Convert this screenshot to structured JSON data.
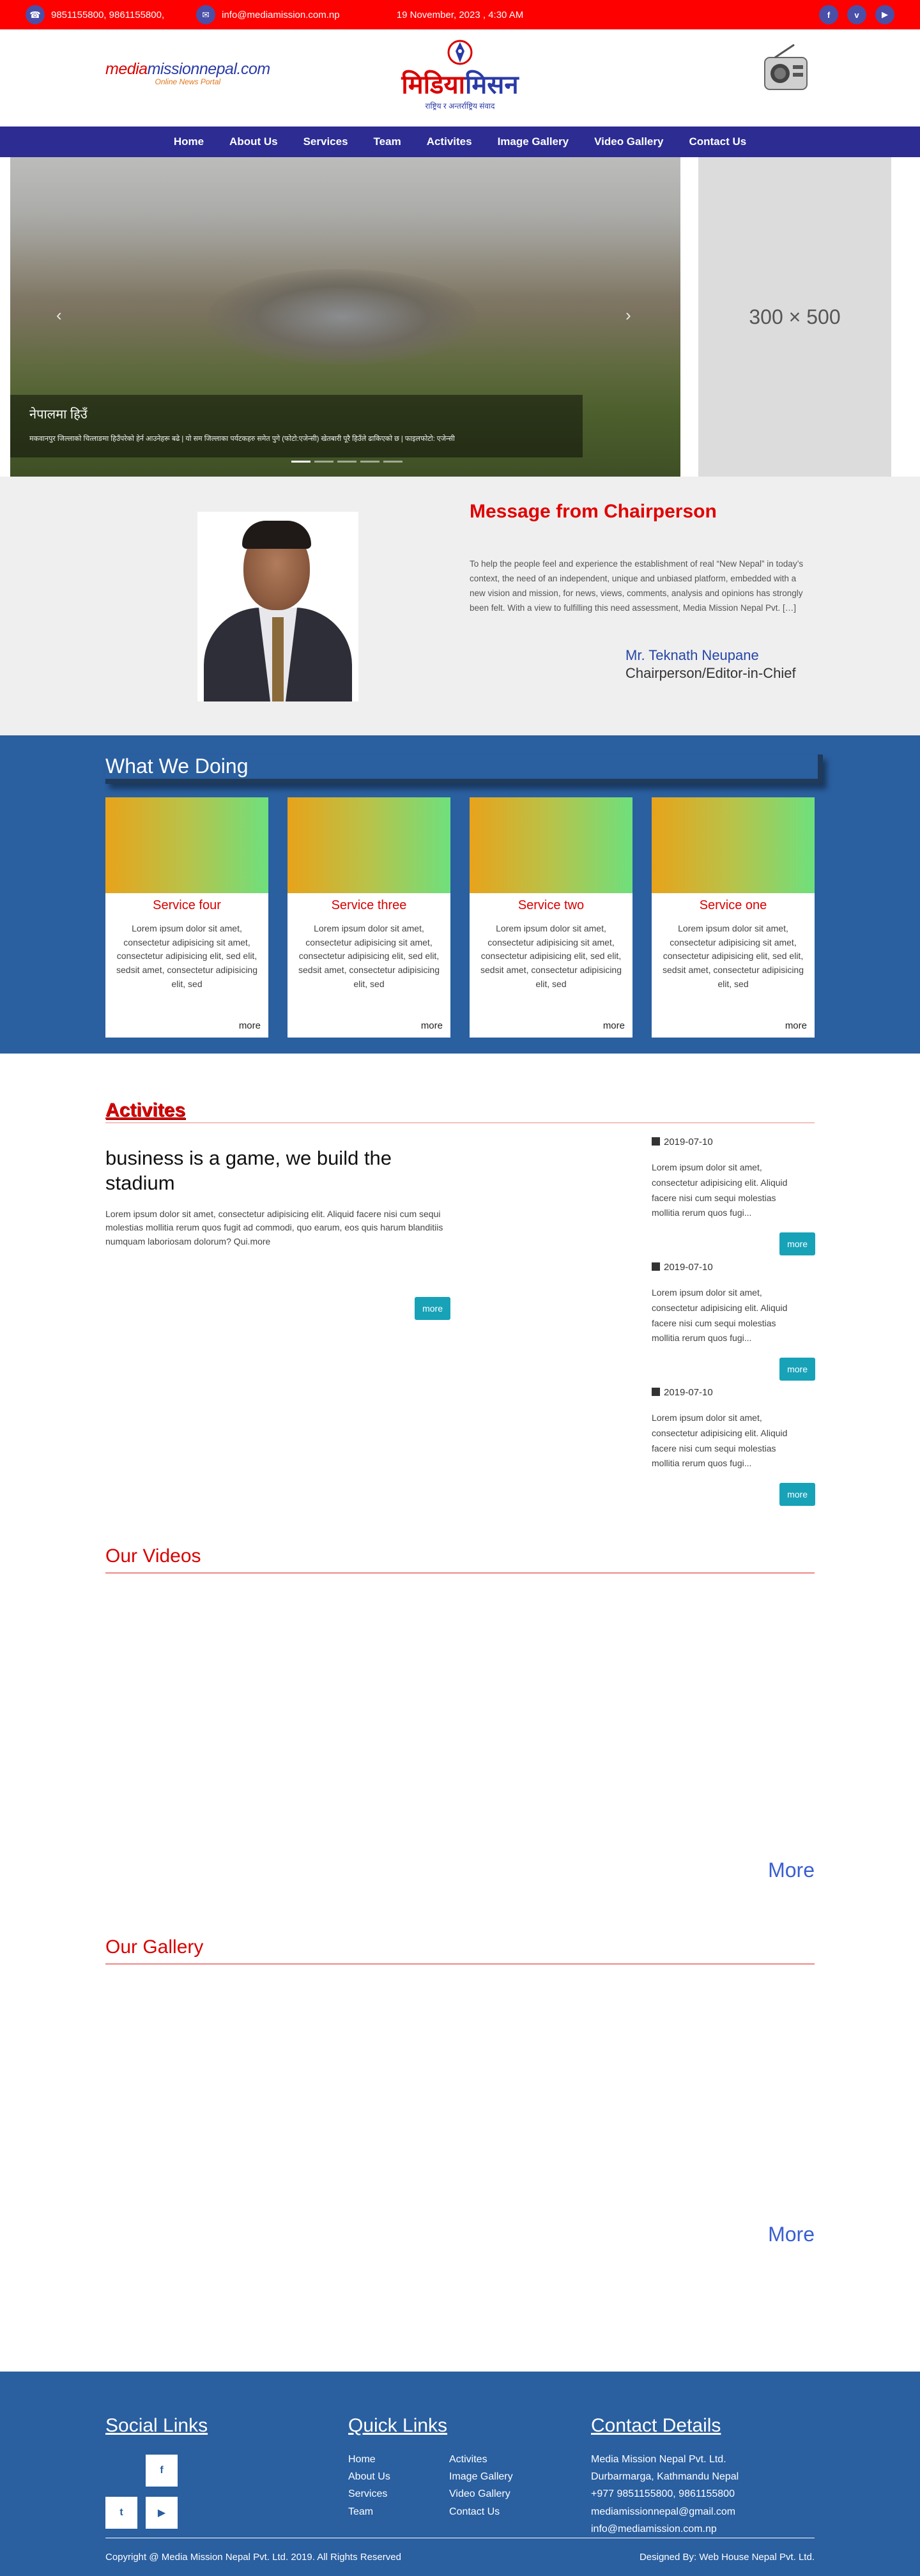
{
  "topbar": {
    "phone": "9851155800, 9861155800,",
    "email": "info@mediamission.com.np",
    "date": "19 November, 2023 , 4:30 AM",
    "social_icons": [
      "facebook-icon",
      "vimeo-icon",
      "youtube-icon"
    ]
  },
  "header": {
    "left_logo_a": "media",
    "left_logo_b": "missionnepal",
    "left_logo_c": ".com",
    "left_logo_tag": "Online News Portal",
    "center_title_a": "मिडिया",
    "center_title_b": "मिसन",
    "center_sub": "राष्ट्रिय र अन्तर्राष्ट्रिय संवाद"
  },
  "nav": [
    "Home",
    "About Us",
    "Services",
    "Team",
    "Activites",
    "Image Gallery",
    "Video Gallery",
    "Contact Us"
  ],
  "slider": {
    "caption_title": "नेपालमा हिउँ",
    "caption_text": "मकवानपुर जिल्लाको चित्लाङमा हिउँपरेको हेर्न आउनेहरू बढे | यो सम जिल्लाका पर्यटकहरु समेत पुगे (फोटो:एजेन्सी) खेतबारी पूरै हिउँले ढाकिएको छ | फाइलफोटो: एजेन्सी",
    "prev": "‹",
    "next": "›",
    "dot_count": 5,
    "active_dot": 0
  },
  "ad": {
    "label": "300 × 500"
  },
  "chair": {
    "title": "Message from Chairperson",
    "message": "To help the people feel and experience the establishment of real “New Nepal” in today’s context, the need of an independent, unique and unbiased platform, embedded with a new vision and mission, for news, views, comments, analysis and opinions has strongly been felt. With a view to fulfilling this need assessment, Media Mission Nepal Pvt. […]",
    "name": "Mr. Teknath Neupane",
    "role": "Chairperson/Editor-in-Chief"
  },
  "doing": {
    "title": "What We Doing",
    "cards": [
      {
        "title": "Service four",
        "text": "Lorem ipsum dolor sit amet, consectetur adipisicing sit amet, consectetur adipisicing elit, sed elit, sedsit amet, consectetur adipisicing elit, sed",
        "more": "more"
      },
      {
        "title": "Service three",
        "text": "Lorem ipsum dolor sit amet, consectetur adipisicing sit amet, consectetur adipisicing elit, sed elit, sedsit amet, consectetur adipisicing elit, sed",
        "more": "more"
      },
      {
        "title": "Service two",
        "text": "Lorem ipsum dolor sit amet, consectetur adipisicing sit amet, consectetur adipisicing elit, sed elit, sedsit amet, consectetur adipisicing elit, sed",
        "more": "more"
      },
      {
        "title": "Service one",
        "text": "Lorem ipsum dolor sit amet, consectetur adipisicing sit amet, consectetur adipisicing elit, sed elit, sedsit amet, consectetur adipisicing elit, sed",
        "more": "more"
      }
    ]
  },
  "activities": {
    "title": "Activites",
    "main_title": "business is a game, we build the stadium",
    "main_text": "Lorem ipsum dolor sit amet, consectetur adipisicing elit. Aliquid facere nisi cum sequi molestias mollitia rerum quos fugit ad commodi, quo earum, eos quis harum blanditiis numquam laboriosam dolorum? Qui.more",
    "main_more": "more",
    "items": [
      {
        "date": "2019-07-10",
        "text": "Lorem ipsum dolor sit amet, consectetur adipisicing elit. Aliquid facere nisi cum sequi molestias mollitia rerum quos fugi...",
        "more": "more"
      },
      {
        "date": "2019-07-10",
        "text": "Lorem ipsum dolor sit amet, consectetur adipisicing elit. Aliquid facere nisi cum sequi molestias mollitia rerum quos fugi...",
        "more": "more"
      },
      {
        "date": "2019-07-10",
        "text": "Lorem ipsum dolor sit amet, consectetur adipisicing elit. Aliquid facere nisi cum sequi molestias mollitia rerum quos fugi...",
        "more": "more"
      }
    ]
  },
  "videos": {
    "title": "Our Videos",
    "more": "More"
  },
  "gallery": {
    "title": "Our Gallery",
    "more": "More"
  },
  "footer": {
    "social_title": "Social Links",
    "quick_title": "Quick Links",
    "contact_title": "Contact Details",
    "quick_col1": [
      "Home",
      "About Us",
      "Services",
      "Team"
    ],
    "quick_col2": [
      "Activites",
      "Image Gallery",
      "Video Gallery",
      "Contact Us"
    ],
    "contact": [
      "Media Mission Nepal Pvt. Ltd.",
      "Durbarmarga, Kathmandu Nepal",
      "+977 9851155800, 9861155800",
      "mediamissionnepal@gmail.com",
      "info@mediamission.com.np"
    ],
    "social_icons": [
      "facebook-icon",
      "twitter-icon",
      "youtube-icon"
    ],
    "copyright": "Copyright @ Media Mission Nepal Pvt. Ltd. 2019. All Rights Reserved",
    "designed": "Designed By: Web House Nepal Pvt. Ltd."
  },
  "colors": {
    "topbar": "#ff0000",
    "nav": "#2c2c93",
    "section_blue": "#2a5fa0",
    "heading_red": "#e10000",
    "button": "#17a2b8"
  }
}
